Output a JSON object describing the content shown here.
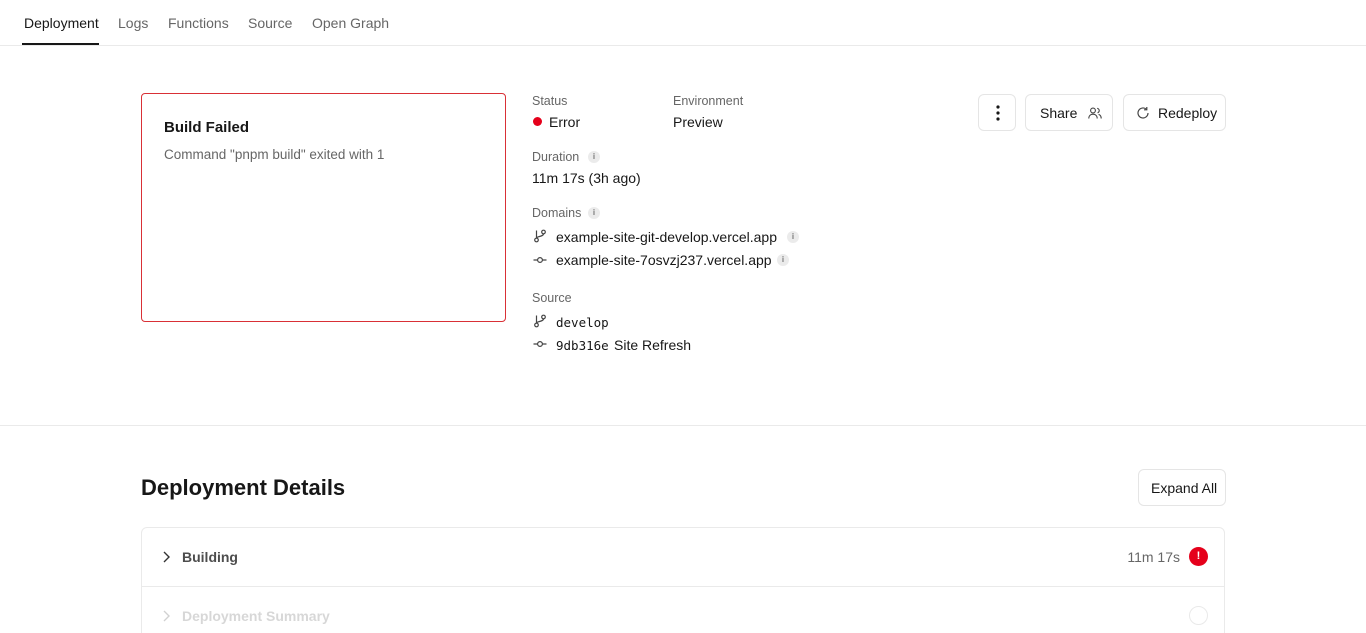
{
  "tabs": [
    {
      "label": "Deployment",
      "active": true
    },
    {
      "label": "Logs",
      "active": false
    },
    {
      "label": "Functions",
      "active": false
    },
    {
      "label": "Source",
      "active": false
    },
    {
      "label": "Open Graph",
      "active": false
    }
  ],
  "build": {
    "title": "Build Failed",
    "message": "Command \"pnpm build\" exited with 1"
  },
  "status": {
    "label": "Status",
    "value": "Error",
    "color": "#e5001b"
  },
  "environment": {
    "label": "Environment",
    "value": "Preview"
  },
  "duration": {
    "label": "Duration",
    "value": "11m 17s (3h ago)"
  },
  "domains": {
    "label": "Domains",
    "items": [
      {
        "icon": "git-branch-icon",
        "text": "example-site-git-develop.vercel.app"
      },
      {
        "icon": "git-commit-icon",
        "text": "example-site-7osvzj237.vercel.app"
      }
    ]
  },
  "source": {
    "label": "Source",
    "branch": "develop",
    "commit_hash": "9db316e",
    "commit_message": "Site Refresh"
  },
  "actions": {
    "more_icon": "more-vertical-icon",
    "share_label": "Share",
    "redeploy_label": "Redeploy"
  },
  "details": {
    "title": "Deployment Details",
    "expand_label": "Expand All",
    "rows": [
      {
        "title": "Building",
        "time": "11m 17s",
        "state": "error"
      },
      {
        "title": "Deployment Summary",
        "time": "",
        "state": "pending"
      }
    ]
  },
  "colors": {
    "error": "#e5001b",
    "border_error": "#d93036"
  }
}
